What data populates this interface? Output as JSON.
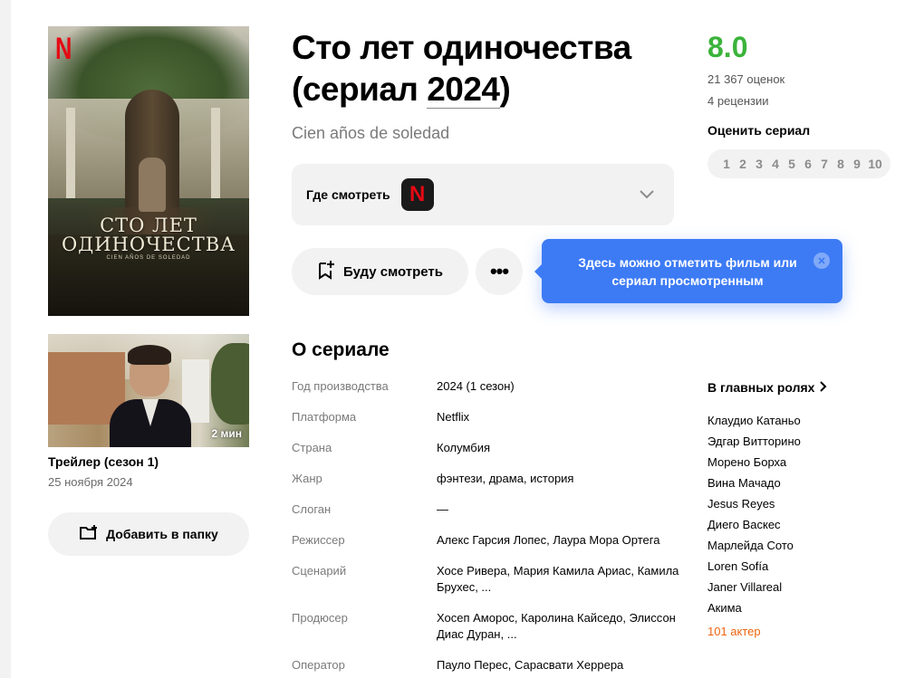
{
  "header": {
    "title_main": "Сто лет одиночества",
    "title_prefix": "(сериал ",
    "title_year": "2024",
    "title_suffix": ")",
    "original_title": "Cien años de soledad"
  },
  "poster": {
    "brand_letter": "N",
    "title_line1": "СТО ЛЕТ",
    "title_line2": "ОДИНОЧЕСТВА",
    "subtitle": "CIEN AÑOS DE SOLEDAD"
  },
  "trailer": {
    "duration": "2 мин",
    "title": "Трейлер (сезон 1)",
    "date": "25 ноября 2024"
  },
  "actions": {
    "add_folder": "Добавить в папку",
    "watch_later": "Буду смотреть",
    "more": "•••"
  },
  "where_to_watch": {
    "label": "Где смотреть",
    "platform_icon": "N"
  },
  "tooltip": {
    "text": "Здесь можно отметить фильм или сериал просмотренным"
  },
  "about": {
    "heading": "О сериале",
    "rows": [
      {
        "key": "Год производства",
        "value": "2024 (1 сезон)"
      },
      {
        "key": "Платформа",
        "value": "Netflix"
      },
      {
        "key": "Страна",
        "value": "Колумбия"
      },
      {
        "key": "Жанр",
        "value": "фэнтези, драма, история"
      },
      {
        "key": "Слоган",
        "value": "—"
      },
      {
        "key": "Режиссер",
        "value": "Алекс Гарсия Лопес, Лаура Мора Ортега"
      },
      {
        "key": "Сценарий",
        "value": "Хосе Ривера, Мария Камила Ариас, Камила Брухес, ..."
      },
      {
        "key": "Продюсер",
        "value": "Хосеп Аморос, Каролина Кайседо, Элиссон Диас Дуран, ..."
      },
      {
        "key": "Оператор",
        "value": "Пауло Перес, Сарасвати Херрера"
      }
    ]
  },
  "rating": {
    "score": "8.0",
    "votes": "21 367 оценок",
    "reviews": "4 рецензии",
    "rate_label": "Оценить сериал",
    "scale": [
      "1",
      "2",
      "3",
      "4",
      "5",
      "6",
      "7",
      "8",
      "9",
      "10"
    ],
    "score_color": "#3bb33b"
  },
  "cast": {
    "heading": "В главных ролях",
    "actors": [
      "Клаудио Катаньо",
      "Эдгар Витторино",
      "Морено Борха",
      "Вина Мачадо",
      "Jesus Reyes",
      "Диего Васкес",
      "Марлейда Сото",
      "Loren Sofía",
      "Janer Villareal",
      "Акима"
    ],
    "more": "101 актер",
    "more_color": "#f0650e"
  },
  "colors": {
    "tooltip_bg": "#3d7bf5",
    "netflix_red": "#e50914"
  }
}
